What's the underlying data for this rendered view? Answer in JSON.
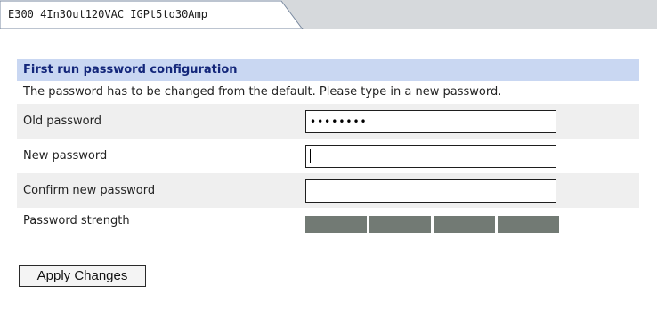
{
  "tab": {
    "label": "E300 4In3Out120VAC IGPt5to30Amp"
  },
  "form": {
    "title": "First run password configuration",
    "description": "The password has to be changed from the default. Please type in a new password.",
    "old_password": {
      "label": "Old password",
      "value": "••••••••"
    },
    "new_password": {
      "label": "New password",
      "value": ""
    },
    "confirm_password": {
      "label": "Confirm new password",
      "value": ""
    },
    "strength": {
      "label": "Password strength",
      "segments": 4,
      "filled": 0,
      "color": "#727a74"
    },
    "apply_label": "Apply Changes"
  },
  "colors": {
    "header_bg": "#c9d7f2",
    "header_text": "#13267a",
    "row_shade": "#efefef",
    "tab_strip": "#d6d9dc"
  }
}
